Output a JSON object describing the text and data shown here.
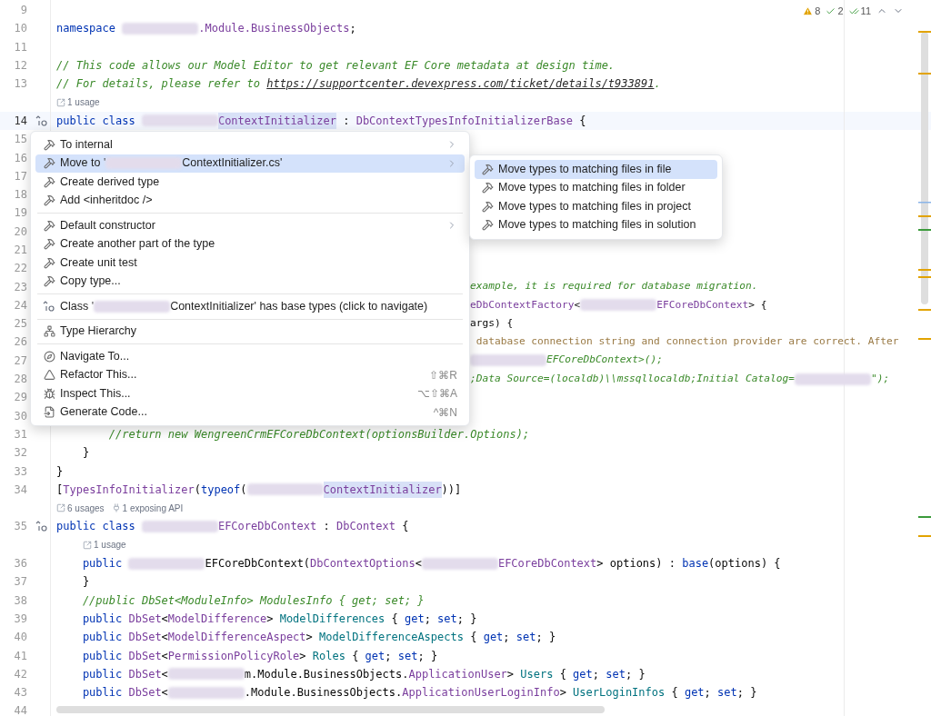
{
  "inspections": {
    "warnings": "8",
    "weak_warnings": "2",
    "typos": "11"
  },
  "lines": [
    {
      "kind": "code",
      "number": "9"
    },
    {
      "kind": "code",
      "number": "10",
      "tokens": [
        {
          "kind": "kw",
          "text": "namespace "
        },
        {
          "kind": "redacted"
        },
        {
          "kind": "type",
          "text": ".Module.BusinessObjects"
        },
        {
          "kind": "plain",
          "text": ";"
        }
      ]
    },
    {
      "kind": "code",
      "number": "11"
    },
    {
      "kind": "code",
      "number": "12",
      "tokens": [
        {
          "kind": "comment",
          "text": "// This code allows our Model Editor to get relevant EF Core metadata at design time."
        }
      ]
    },
    {
      "kind": "code",
      "number": "13",
      "tokens": [
        {
          "kind": "comment",
          "text": "// For details, please refer to "
        },
        {
          "kind": "link",
          "text": "https://supportcenter.devexpress.com/ticket/details/t933891"
        },
        {
          "kind": "comment",
          "text": "."
        }
      ]
    },
    {
      "kind": "hint",
      "hints": [
        "1 usage"
      ]
    },
    {
      "kind": "code",
      "number": "14",
      "current": true,
      "implements": true,
      "tokens": [
        {
          "kind": "kw",
          "text": "public class "
        },
        {
          "kind": "redacted"
        },
        {
          "kind": "ident",
          "text": "ContextInitializer"
        },
        {
          "kind": "plain",
          "text": " : "
        },
        {
          "kind": "type",
          "text": "DbContextTypesInfoInitializerBase"
        },
        {
          "kind": "plain",
          "text": " {"
        }
      ]
    },
    {
      "kind": "code",
      "number": "15"
    },
    {
      "kind": "code",
      "number": "16"
    },
    {
      "kind": "code",
      "number": "17"
    },
    {
      "kind": "code",
      "number": "18"
    },
    {
      "kind": "code",
      "number": "19"
    },
    {
      "kind": "code",
      "number": "20"
    },
    {
      "kind": "code",
      "number": "21"
    },
    {
      "kind": "code",
      "number": "22"
    },
    {
      "kind": "code",
      "number": "23",
      "covered": true,
      "tokens": [
        {
          "kind": "comment",
          "text": "example, it is required for database migration."
        }
      ]
    },
    {
      "kind": "code",
      "number": "24",
      "covered": true,
      "tokens": [
        {
          "kind": "type",
          "text": "eDbContextFactory"
        },
        {
          "kind": "plain",
          "text": "<"
        },
        {
          "kind": "redacted"
        },
        {
          "kind": "type",
          "text": "EFCoreDbContext"
        },
        {
          "kind": "plain",
          "text": "> {"
        }
      ]
    },
    {
      "kind": "code",
      "number": "25",
      "covered": true,
      "tokens": [
        {
          "kind": "plain",
          "text": "args) {"
        }
      ]
    },
    {
      "kind": "code",
      "number": "26",
      "covered": true,
      "tokens": [
        {
          "kind": "todo",
          "text": " database connection string and connection provider are correct. After"
        }
      ]
    },
    {
      "kind": "code",
      "number": "27",
      "covered": true,
      "tokens": [
        {
          "kind": "redacted"
        },
        {
          "kind": "comment",
          "text": "EFCoreDbContext>();"
        }
      ]
    },
    {
      "kind": "code",
      "number": "28",
      "covered": true,
      "tokens": [
        {
          "kind": "comment",
          "text": ";Data Source=(localdb)\\\\mssqllocaldb;Initial Catalog="
        },
        {
          "kind": "redacted"
        },
        {
          "kind": "comment",
          "text": "\");"
        }
      ]
    },
    {
      "kind": "code",
      "number": "29"
    },
    {
      "kind": "code",
      "number": "30"
    },
    {
      "kind": "code",
      "number": "31",
      "tokens": [
        {
          "kind": "comment",
          "text": "        //return new WengreenCrmEFCoreDbContext(optionsBuilder.Options);"
        }
      ]
    },
    {
      "kind": "code",
      "number": "32",
      "tokens": [
        {
          "kind": "plain",
          "text": "    }"
        }
      ]
    },
    {
      "kind": "code",
      "number": "33",
      "tokens": [
        {
          "kind": "plain",
          "text": "}"
        }
      ]
    },
    {
      "kind": "code",
      "number": "34",
      "tokens": [
        {
          "kind": "plain",
          "text": "["
        },
        {
          "kind": "type",
          "text": "TypesInfoInitializer"
        },
        {
          "kind": "plain",
          "text": "("
        },
        {
          "kind": "kw",
          "text": "typeof"
        },
        {
          "kind": "plain",
          "text": "("
        },
        {
          "kind": "redacted"
        },
        {
          "kind": "ident",
          "text": "ContextInitializer"
        },
        {
          "kind": "plain",
          "text": "))]"
        }
      ]
    },
    {
      "kind": "hint",
      "hints": [
        "6 usages",
        "1 exposing API"
      ]
    },
    {
      "kind": "code",
      "number": "35",
      "implements": true,
      "tokens": [
        {
          "kind": "kw",
          "text": "public class "
        },
        {
          "kind": "redacted"
        },
        {
          "kind": "type",
          "text": "EFCoreDbContext"
        },
        {
          "kind": "plain",
          "text": " : "
        },
        {
          "kind": "type",
          "text": "DbContext"
        },
        {
          "kind": "plain",
          "text": " {"
        }
      ]
    },
    {
      "kind": "hint",
      "indented": true,
      "hints": [
        "1 usage"
      ]
    },
    {
      "kind": "code",
      "number": "36",
      "tokens": [
        {
          "kind": "kw",
          "text": "    public "
        },
        {
          "kind": "redacted"
        },
        {
          "kind": "plain",
          "text": "EFCoreDbContext("
        },
        {
          "kind": "type",
          "text": "DbContextOptions"
        },
        {
          "kind": "plain",
          "text": "<"
        },
        {
          "kind": "redacted"
        },
        {
          "kind": "type",
          "text": "EFCoreDbContext"
        },
        {
          "kind": "plain",
          "text": "> options) : "
        },
        {
          "kind": "kw",
          "text": "base"
        },
        {
          "kind": "plain",
          "text": "(options) {"
        }
      ]
    },
    {
      "kind": "code",
      "number": "37",
      "tokens": [
        {
          "kind": "plain",
          "text": "    }"
        }
      ]
    },
    {
      "kind": "code",
      "number": "38",
      "tokens": [
        {
          "kind": "comment",
          "text": "    //public DbSet<ModuleInfo> ModulesInfo { get; set; }"
        }
      ]
    },
    {
      "kind": "code",
      "number": "39",
      "tokens": [
        {
          "kind": "kw",
          "text": "    public "
        },
        {
          "kind": "type",
          "text": "DbSet"
        },
        {
          "kind": "plain",
          "text": "<"
        },
        {
          "kind": "type",
          "text": "ModelDifference"
        },
        {
          "kind": "plain",
          "text": "> "
        },
        {
          "kind": "prop",
          "text": "ModelDifferences"
        },
        {
          "kind": "plain",
          "text": " { "
        },
        {
          "kind": "kw",
          "text": "get"
        },
        {
          "kind": "plain",
          "text": "; "
        },
        {
          "kind": "kw",
          "text": "set"
        },
        {
          "kind": "plain",
          "text": "; }"
        }
      ]
    },
    {
      "kind": "code",
      "number": "40",
      "tokens": [
        {
          "kind": "kw",
          "text": "    public "
        },
        {
          "kind": "type",
          "text": "DbSet"
        },
        {
          "kind": "plain",
          "text": "<"
        },
        {
          "kind": "type",
          "text": "ModelDifferenceAspect"
        },
        {
          "kind": "plain",
          "text": "> "
        },
        {
          "kind": "prop",
          "text": "ModelDifferenceAspects"
        },
        {
          "kind": "plain",
          "text": " { "
        },
        {
          "kind": "kw",
          "text": "get"
        },
        {
          "kind": "plain",
          "text": "; "
        },
        {
          "kind": "kw",
          "text": "set"
        },
        {
          "kind": "plain",
          "text": "; }"
        }
      ]
    },
    {
      "kind": "code",
      "number": "41",
      "tokens": [
        {
          "kind": "kw",
          "text": "    public "
        },
        {
          "kind": "type",
          "text": "DbSet"
        },
        {
          "kind": "plain",
          "text": "<"
        },
        {
          "kind": "type",
          "text": "PermissionPolicyRole"
        },
        {
          "kind": "plain",
          "text": "> "
        },
        {
          "kind": "prop",
          "text": "Roles"
        },
        {
          "kind": "plain",
          "text": " { "
        },
        {
          "kind": "kw",
          "text": "get"
        },
        {
          "kind": "plain",
          "text": "; "
        },
        {
          "kind": "kw",
          "text": "set"
        },
        {
          "kind": "plain",
          "text": "; }"
        }
      ]
    },
    {
      "kind": "code",
      "number": "42",
      "tokens": [
        {
          "kind": "kw",
          "text": "    public "
        },
        {
          "kind": "type",
          "text": "DbSet"
        },
        {
          "kind": "plain",
          "text": "<"
        },
        {
          "kind": "redacted"
        },
        {
          "kind": "plain",
          "text": "m.Module.BusinessObjects."
        },
        {
          "kind": "type",
          "text": "ApplicationUser"
        },
        {
          "kind": "plain",
          "text": "> "
        },
        {
          "kind": "prop",
          "text": "Users"
        },
        {
          "kind": "plain",
          "text": " { "
        },
        {
          "kind": "kw",
          "text": "get"
        },
        {
          "kind": "plain",
          "text": "; "
        },
        {
          "kind": "kw",
          "text": "set"
        },
        {
          "kind": "plain",
          "text": "; }"
        }
      ]
    },
    {
      "kind": "code",
      "number": "43",
      "tokens": [
        {
          "kind": "kw",
          "text": "    public "
        },
        {
          "kind": "type",
          "text": "DbSet"
        },
        {
          "kind": "plain",
          "text": "<"
        },
        {
          "kind": "redacted"
        },
        {
          "kind": "plain",
          "text": ".Module.BusinessObjects."
        },
        {
          "kind": "type",
          "text": "ApplicationUserLoginInfo"
        },
        {
          "kind": "plain",
          "text": "> "
        },
        {
          "kind": "prop",
          "text": "UserLoginInfos"
        },
        {
          "kind": "plain",
          "text": " { "
        },
        {
          "kind": "kw",
          "text": "get"
        },
        {
          "kind": "plain",
          "text": "; "
        },
        {
          "kind": "kw",
          "text": "set"
        },
        {
          "kind": "plain",
          "text": "; }"
        }
      ]
    },
    {
      "kind": "code",
      "number": "44"
    }
  ],
  "context_menu": {
    "items": [
      {
        "kind": "item",
        "parts": [
          {
            "kind": "text",
            "text": "To internal"
          }
        ],
        "submenu": true,
        "selected": false
      },
      {
        "kind": "item",
        "parts": [
          {
            "kind": "text",
            "text": "Move to '"
          },
          {
            "kind": "redacted"
          },
          {
            "kind": "text",
            "text": "ContextInitializer.cs'"
          }
        ],
        "submenu": true,
        "selected": true
      },
      {
        "kind": "item",
        "parts": [
          {
            "kind": "text",
            "text": "Create derived type"
          }
        ],
        "selected": false
      },
      {
        "kind": "item",
        "parts": [
          {
            "kind": "text",
            "text": "Add <inheritdoc />"
          }
        ],
        "selected": false
      },
      {
        "kind": "separator"
      },
      {
        "kind": "item",
        "parts": [
          {
            "kind": "text",
            "text": "Default constructor"
          }
        ],
        "submenu": true,
        "selected": false
      },
      {
        "kind": "item",
        "parts": [
          {
            "kind": "text",
            "text": "Create another part of the type"
          }
        ],
        "selected": false
      },
      {
        "kind": "item",
        "parts": [
          {
            "kind": "text",
            "text": "Create unit test"
          }
        ],
        "selected": false
      },
      {
        "kind": "item",
        "parts": [
          {
            "kind": "text",
            "text": "Copy type..."
          }
        ],
        "selected": false
      },
      {
        "kind": "separator"
      },
      {
        "kind": "item",
        "parts": [
          {
            "kind": "text",
            "text": "Class '"
          },
          {
            "kind": "redacted"
          },
          {
            "kind": "text",
            "text": "ContextInitializer' has base types (click to navigate)"
          }
        ],
        "selected": false
      },
      {
        "kind": "separator"
      },
      {
        "kind": "item",
        "parts": [
          {
            "kind": "text",
            "text": "Type Hierarchy"
          }
        ],
        "selected": false
      },
      {
        "kind": "separator"
      },
      {
        "kind": "item",
        "parts": [
          {
            "kind": "text",
            "text": "Navigate To..."
          }
        ],
        "selected": false
      },
      {
        "kind": "item",
        "parts": [
          {
            "kind": "text",
            "text": "Refactor This..."
          }
        ],
        "shortcut": "⇧⌘R",
        "selected": false
      },
      {
        "kind": "item",
        "parts": [
          {
            "kind": "text",
            "text": "Inspect This..."
          }
        ],
        "shortcut": "⌥⇧⌘A",
        "selected": false
      },
      {
        "kind": "item",
        "parts": [
          {
            "kind": "text",
            "text": "Generate Code..."
          }
        ],
        "shortcut": "^⌘N",
        "selected": false
      }
    ]
  },
  "submenu": {
    "items": [
      {
        "label": "Move types to matching files in file",
        "selected": true
      },
      {
        "label": "Move types to matching files in folder",
        "selected": false
      },
      {
        "label": "Move types to matching files in project",
        "selected": false
      },
      {
        "label": "Move types to matching files in solution",
        "selected": false
      }
    ]
  }
}
